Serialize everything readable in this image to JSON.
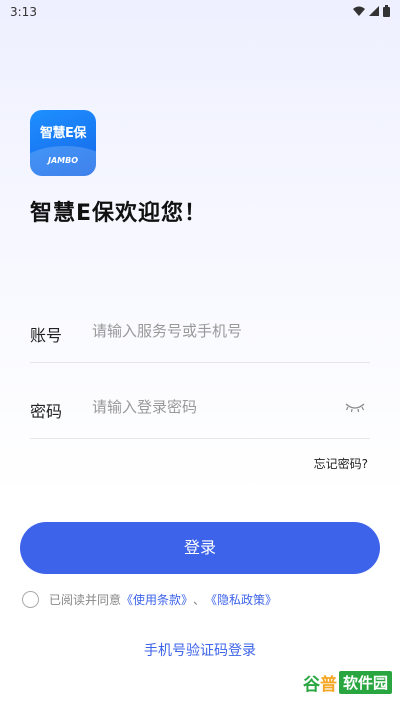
{
  "status_bar": {
    "time": "3:13"
  },
  "app": {
    "logo_text": "智慧E保",
    "logo_sub": "JAMBO",
    "welcome": "智慧E保欢迎您！"
  },
  "form": {
    "account": {
      "label": "账号",
      "placeholder": "请输入服务号或手机号",
      "value": ""
    },
    "password": {
      "label": "密码",
      "placeholder": "请输入登录密码",
      "value": ""
    },
    "forgot": "忘记密码?"
  },
  "login_button": "登录",
  "agreement": {
    "checked": false,
    "prefix": "已阅读并同意",
    "terms": "《使用条款》",
    "separator": "、",
    "privacy": "《隐私政策》"
  },
  "sms_login": "手机号验证码登录",
  "watermark": {
    "part1": "谷",
    "part2": "普",
    "part3": "软件园"
  },
  "colors": {
    "primary": "#3d63ea",
    "logo": "#1e90ff"
  }
}
